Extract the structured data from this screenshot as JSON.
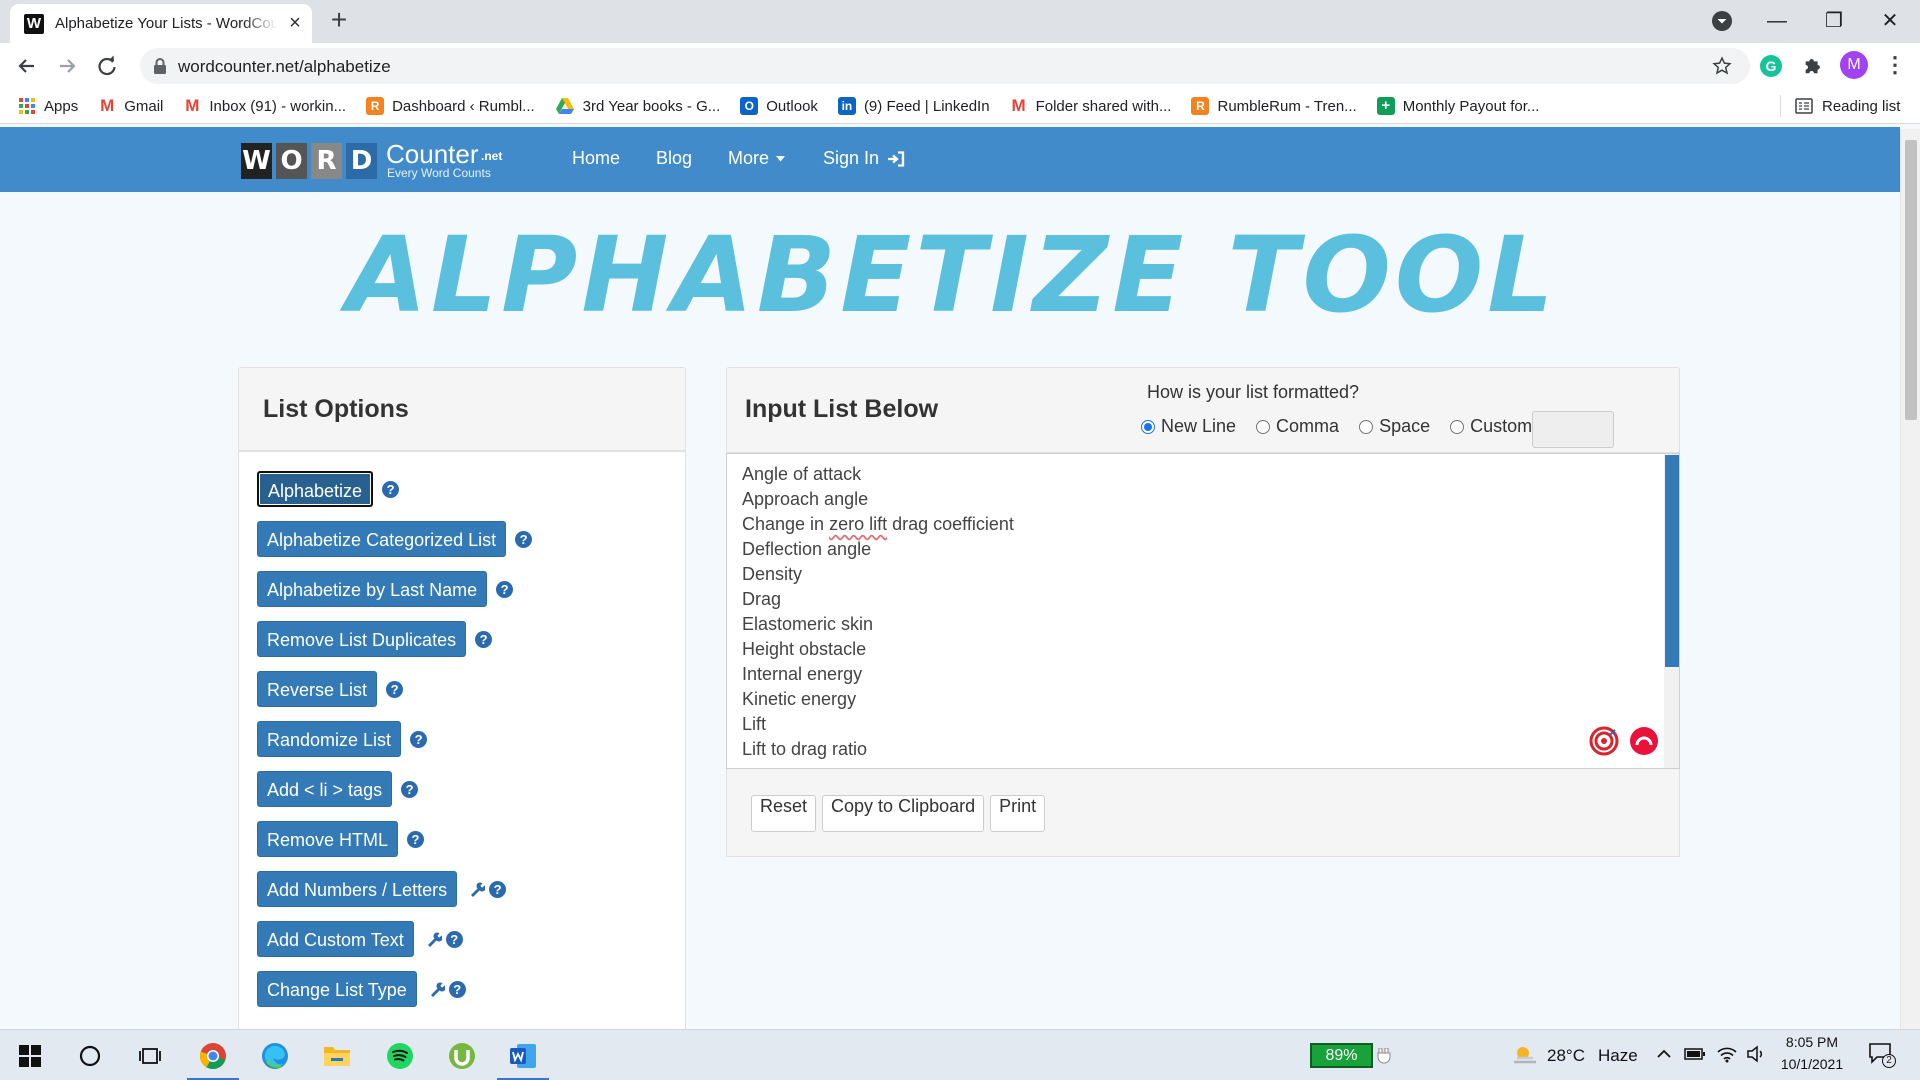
{
  "browser": {
    "tab": {
      "favicon": "W",
      "title": "Alphabetize Your Lists - WordCou",
      "close": "×"
    },
    "new_tab": "+",
    "window_controls": {
      "minimize": "—",
      "restore": "❐",
      "close": "✕"
    },
    "address": {
      "url": "wordcounter.net/alphabetize"
    },
    "extension_initial": "G",
    "profile_initial": "M",
    "menu": "⋮",
    "bookmarks": [
      {
        "label": "Apps",
        "icon": "apps-grid-icon"
      },
      {
        "label": "Gmail",
        "icon": "gmail-icon"
      },
      {
        "label": "Inbox (91) - workin...",
        "icon": "gmail-icon"
      },
      {
        "label": "Dashboard ‹ Rumbl...",
        "icon": "rumble-icon"
      },
      {
        "label": "3rd Year books - G...",
        "icon": "drive-icon"
      },
      {
        "label": "Outlook",
        "icon": "outlook-icon"
      },
      {
        "label": "(9) Feed | LinkedIn",
        "icon": "linkedin-icon"
      },
      {
        "label": "Folder shared with...",
        "icon": "gmail-icon"
      },
      {
        "label": "RumbleRum - Tren...",
        "icon": "rumble-icon"
      },
      {
        "label": "Monthly Payout for...",
        "icon": "sheets-icon"
      }
    ],
    "reading_list": "Reading list"
  },
  "site": {
    "logo": {
      "letters": [
        "W",
        "O",
        "R",
        "D"
      ],
      "counter": "Counter",
      "tld": ".net",
      "tagline": "Every Word Counts"
    },
    "nav": {
      "home": "Home",
      "blog": "Blog",
      "more": "More",
      "sign_in": "Sign In"
    },
    "page_title": "ALPHABETIZE TOOL",
    "list_options": {
      "heading": "List Options",
      "buttons": [
        {
          "label": "Alphabetize",
          "active": true,
          "wrench": false
        },
        {
          "label": "Alphabetize Categorized List",
          "wrench": false
        },
        {
          "label": "Alphabetize by Last Name",
          "wrench": false
        },
        {
          "label": "Remove List Duplicates",
          "wrench": false
        },
        {
          "label": "Reverse List",
          "wrench": false
        },
        {
          "label": "Randomize List",
          "wrench": false
        },
        {
          "label": "Add < li > tags",
          "wrench": false
        },
        {
          "label": "Remove HTML",
          "wrench": false
        },
        {
          "label": "Add Numbers / Letters",
          "wrench": true
        },
        {
          "label": "Add Custom Text",
          "wrench": true
        },
        {
          "label": "Change List Type",
          "wrench": true
        }
      ],
      "help_glyph": "?"
    },
    "input": {
      "heading": "Input List Below",
      "format_question": "How is your list formatted?",
      "formats": [
        {
          "label": "New Line",
          "checked": true
        },
        {
          "label": "Comma",
          "checked": false
        },
        {
          "label": "Space",
          "checked": false
        },
        {
          "label": "Custom",
          "checked": false
        }
      ],
      "custom_value": "",
      "lines": [
        "Angle of attack",
        "Approach angle",
        "Change in zero lift drag coefficient",
        "Deflection angle",
        "Density",
        "Drag",
        "Elastomeric skin",
        "Height obstacle",
        "Internal energy",
        "Kinetic energy",
        "Lift",
        "Lift to drag ratio"
      ],
      "line_3_parts": [
        "Change in ",
        "zero lift",
        " drag coefficient"
      ],
      "actions": {
        "reset": "Reset",
        "copy": "Copy to Clipboard",
        "print": "Print"
      }
    }
  },
  "taskbar": {
    "battery": "89%",
    "temperature": "28°C",
    "condition": "Haze",
    "time": "8:05 PM",
    "date": "10/1/2021",
    "notifications": "2"
  },
  "colors": {
    "header_blue": "#428bca",
    "button_blue": "#337ab7",
    "title_cyan": "#5bc0de",
    "page_bg": "#f4f9fd"
  }
}
